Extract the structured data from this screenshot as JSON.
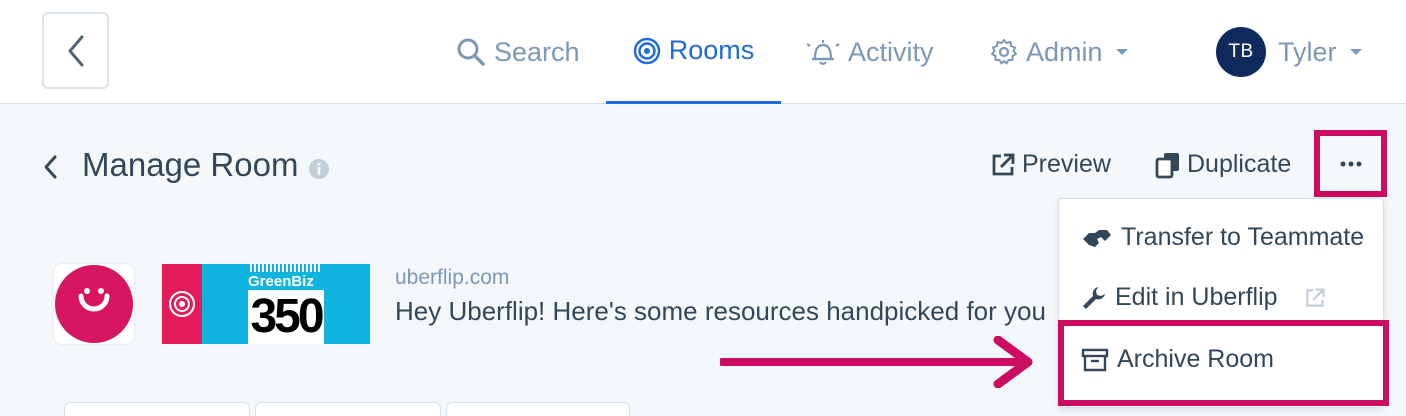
{
  "nav": {
    "search_label": "Search",
    "rooms_label": "Rooms",
    "activity_label": "Activity",
    "admin_label": "Admin",
    "user_initials": "TB",
    "user_name": "Tyler",
    "active_tab": "Rooms"
  },
  "header": {
    "title": "Manage Room",
    "preview_label": "Preview",
    "duplicate_label": "Duplicate"
  },
  "menu": {
    "items": [
      {
        "label": "Transfer to Teammate",
        "icon": "handshake-icon"
      },
      {
        "label": "Edit in Uberflip",
        "icon": "wrench-icon"
      },
      {
        "label": "Archive Room",
        "icon": "archive-icon"
      }
    ]
  },
  "room": {
    "domain": "uberflip.com",
    "welcome": "Hey Uberflip! Here's some resources handpicked for you",
    "banner_brand": "GreenBiz",
    "banner_number": "350"
  },
  "colors": {
    "accent": "#1e6be0",
    "highlight": "#cc0c63",
    "avatar_bg": "#0f2a5c",
    "text": "#33475b",
    "muted": "#7c98b6"
  }
}
